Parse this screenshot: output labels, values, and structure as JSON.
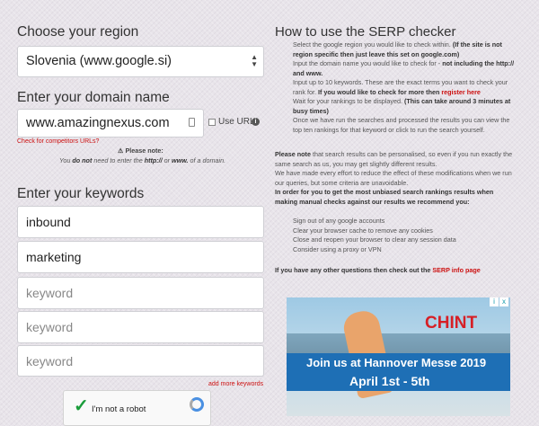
{
  "region": {
    "heading": "Choose your region",
    "selected": "Slovenia (www.google.si)"
  },
  "domain": {
    "heading": "Enter your domain name",
    "value": "www.amazingnexus.com",
    "use_url_label": "Use URL",
    "competitors_link": "Check for competitors URLs?",
    "note_title": "Please note:",
    "note_pre": "You ",
    "note_b1": "do not",
    "note_mid": " need to enter the ",
    "note_b2": "http://",
    "note_or": " or ",
    "note_b3": "www.",
    "note_post": " of a domain."
  },
  "keywords": {
    "heading": "Enter your keywords",
    "fields": [
      {
        "value": "inbound",
        "placeholder": ""
      },
      {
        "value": "marketing",
        "placeholder": ""
      },
      {
        "value": "",
        "placeholder": "keyword"
      },
      {
        "value": "",
        "placeholder": "keyword"
      },
      {
        "value": "",
        "placeholder": "keyword"
      }
    ],
    "add_more": "add more keywords"
  },
  "captcha": {
    "label": "I'm not a robot"
  },
  "help": {
    "heading": "How to use the SERP checker",
    "s1": "Select the google region you would like to check within.",
    "s1b": "(If the site is not region specific then just leave this set on google.com)",
    "s2": "Input the domain name you would like to check for -",
    "s2b": "not including the http:// and www.",
    "s3": "Input up to 10 keywords. These are the exact terms you want to check your rank for.",
    "s3b": "If you would like to check for more then",
    "s3link": "register here",
    "s4": "Wait for your rankings to be displayed.",
    "s4b": "(This can take around 3 minutes at busy times)",
    "s5": "Once we have run the searches and processed the results you can view the top ten rankings for that keyword or click to run the search yourself.",
    "note1_b": "Please note",
    "note1": " that search results can be personalised, so even if you run exactly the same search as us, you may get slightly different results.",
    "note2": "We have made every effort to reduce the effect of these modifications when we run our queries, but some criteria are unavoidable.",
    "note3": "In order for you to get the most unbiased search rankings results when making manual checks against our results we recommend you:",
    "tips": [
      "Sign out of any google accounts",
      "Clear your browser cache to remove any cookies",
      "Close and reopen your browser to clear any session data",
      "Consider using a proxy or VPN"
    ],
    "final": "If you have any other questions then check out the",
    "final_link": "SERP info page"
  },
  "ad": {
    "brand": "CHINT",
    "line1": "Join us at Hannover Messe 2019",
    "line2": "April 1st - 5th",
    "info": "i",
    "close": "x"
  },
  "colors": {
    "link": "#cc1111",
    "ad_banner": "#1e6fb5",
    "check": "#1a9c3a"
  }
}
